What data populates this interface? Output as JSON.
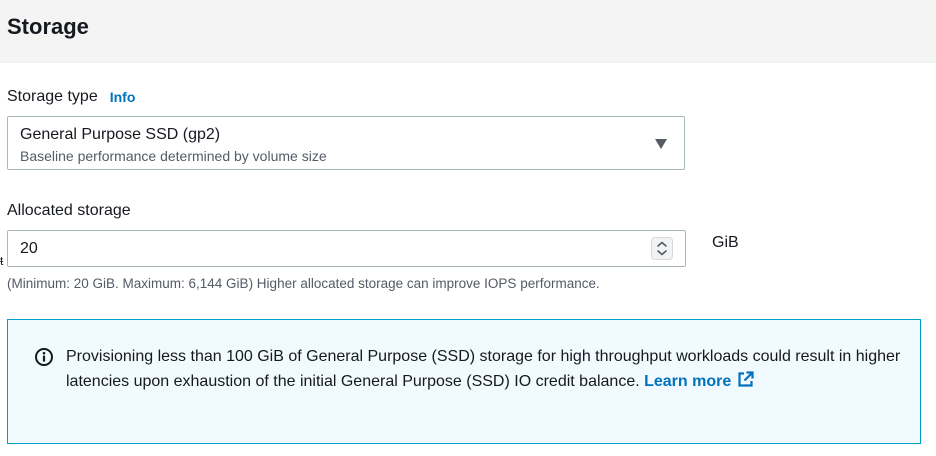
{
  "section": {
    "title": "Storage"
  },
  "storage_type": {
    "label": "Storage type",
    "info_link": "Info",
    "selected_value": "General Purpose SSD (gp2)",
    "selected_description": "Baseline performance determined by volume size"
  },
  "allocated_storage": {
    "label": "Allocated storage",
    "value": "20",
    "unit": "GiB",
    "hint": "(Minimum: 20 GiB. Maximum: 6,144 GiB) Higher allocated storage can improve IOPS performance."
  },
  "alert": {
    "message": "Provisioning less than 100 GiB of General Purpose (SSD) storage for high throughput workloads could result in higher latencies upon exhaustion of the initial General Purpose (SSD) IO credit balance. ",
    "link_text": "Learn more"
  },
  "edge_glyph": "ŧ",
  "colors": {
    "header_bg": "#f4f4f4",
    "link": "#0073bb",
    "alert_bg": "#f1faff",
    "alert_border": "#00a1c9",
    "input_border": "#aab7b8"
  },
  "icons": {
    "alert": "info-circle-icon",
    "link": "external-link-icon",
    "select": "caret-down-icon",
    "stepper": "up-down-chevron-icon"
  }
}
